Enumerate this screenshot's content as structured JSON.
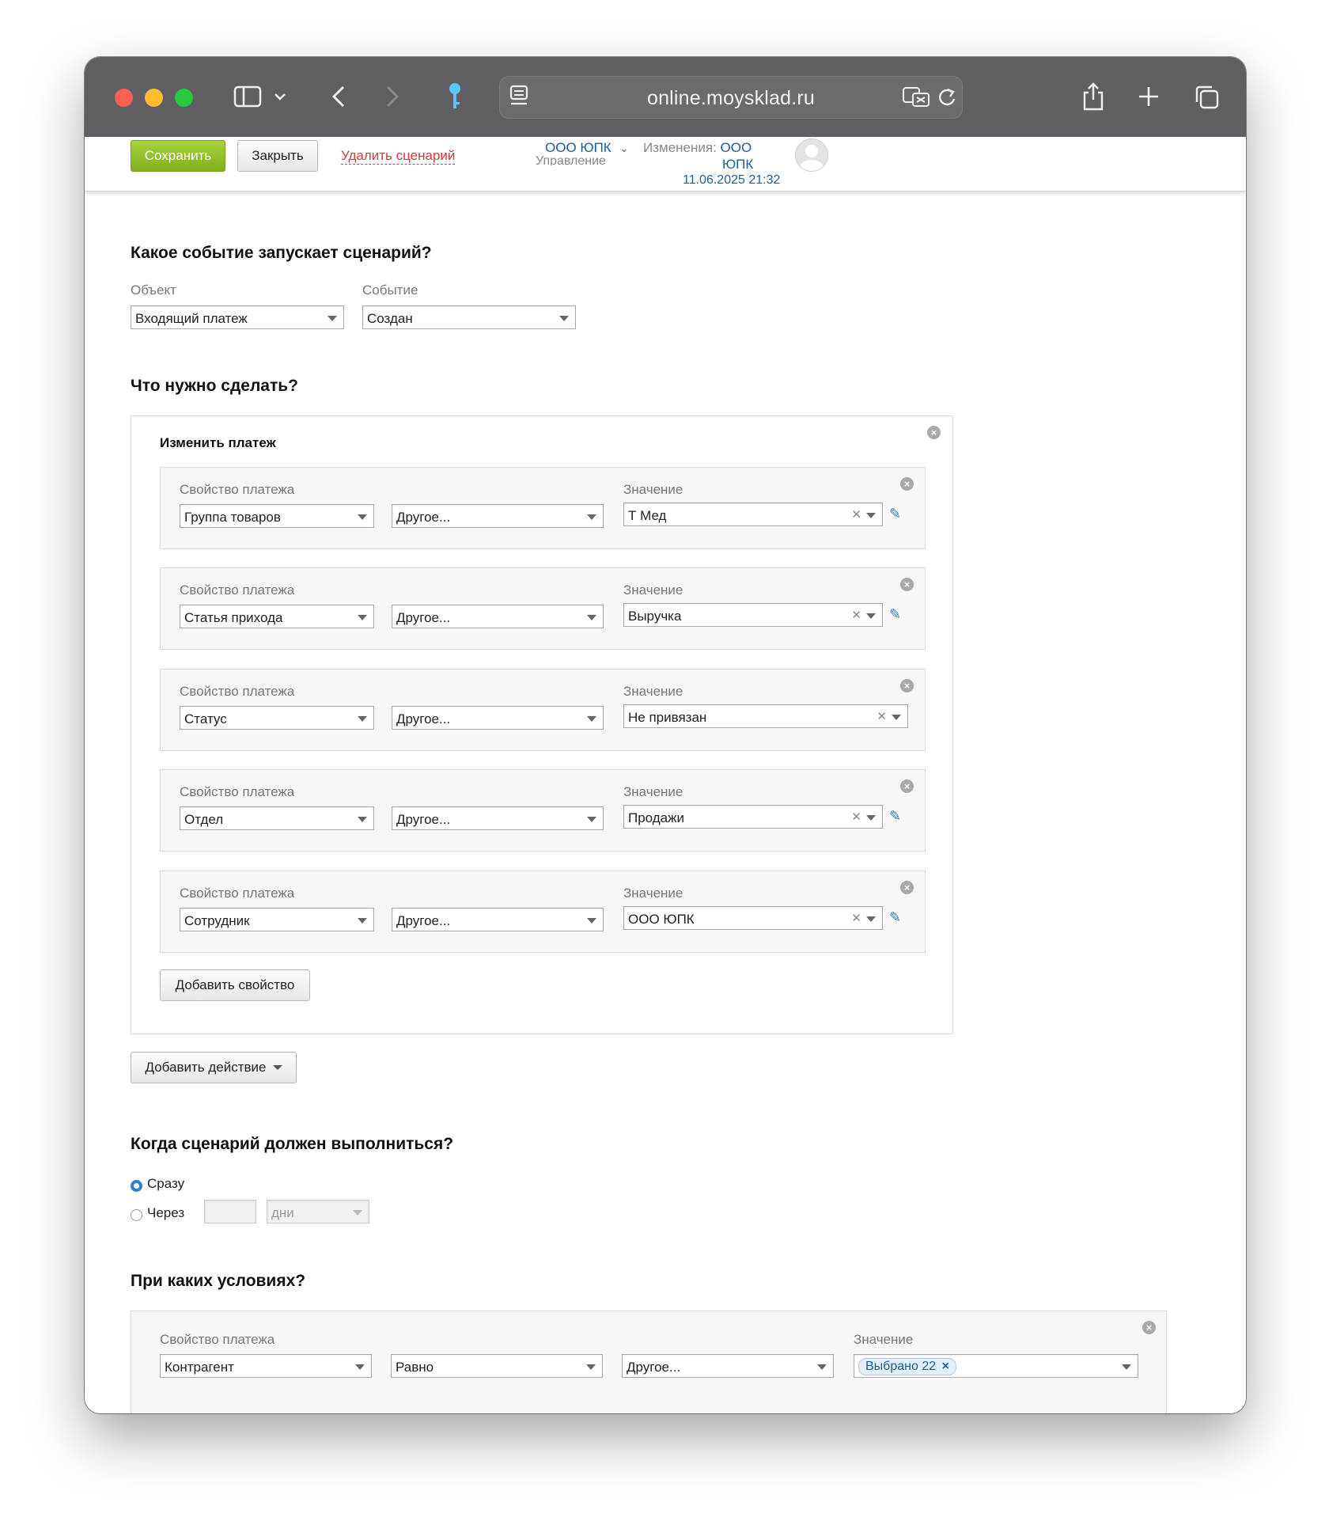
{
  "browser": {
    "url": "online.moysklad.ru"
  },
  "header": {
    "save_label": "Сохранить",
    "close_label": "Закрыть",
    "delete_label": "Удалить сценарий",
    "org_name": "ООО ЮПК",
    "org_sub": "Управление",
    "changes_label": "Изменения:",
    "changes_org_line1": "ООО",
    "changes_org_line2": "ЮПК",
    "changes_date": "11.06.2025 21:32"
  },
  "trigger": {
    "title": "Какое событие запускает сценарий?",
    "object_label": "Объект",
    "object_value": "Входящий платеж",
    "event_label": "Событие",
    "event_value": "Создан"
  },
  "actions": {
    "title": "Что нужно сделать?",
    "action_title": "Изменить платеж",
    "property_label": "Свойство платежа",
    "value_label": "Значение",
    "rows": [
      {
        "property": "Группа товаров",
        "mode": "Другое...",
        "value": "Т Мед"
      },
      {
        "property": "Статья прихода",
        "mode": "Другое...",
        "value": "Выручка"
      },
      {
        "property": "Статус",
        "mode": "Другое...",
        "value": "Не привязан"
      },
      {
        "property": "Отдел",
        "mode": "Другое...",
        "value": "Продажи"
      },
      {
        "property": "Сотрудник",
        "mode": "Другое...",
        "value": "ООО ЮПК"
      }
    ],
    "add_property_label": "Добавить свойство",
    "add_action_label": "Добавить действие"
  },
  "timing": {
    "title": "Когда сценарий должен выполниться?",
    "immediately_label": "Сразу",
    "after_label": "Через",
    "after_value": "",
    "unit_value": "дни",
    "selected": "immediately"
  },
  "conditions": {
    "title": "При каких условиях?",
    "property_label": "Свойство платежа",
    "value_label": "Значение",
    "property": "Контрагент",
    "operator": "Равно",
    "mode": "Другое...",
    "value_chip": "Выбрано 22"
  },
  "colors": {
    "save_green": "#8cbf2a",
    "link_blue": "#1a5e9b",
    "delete_red": "#d23a3a",
    "toolbar_gray": "#5f5f63"
  }
}
